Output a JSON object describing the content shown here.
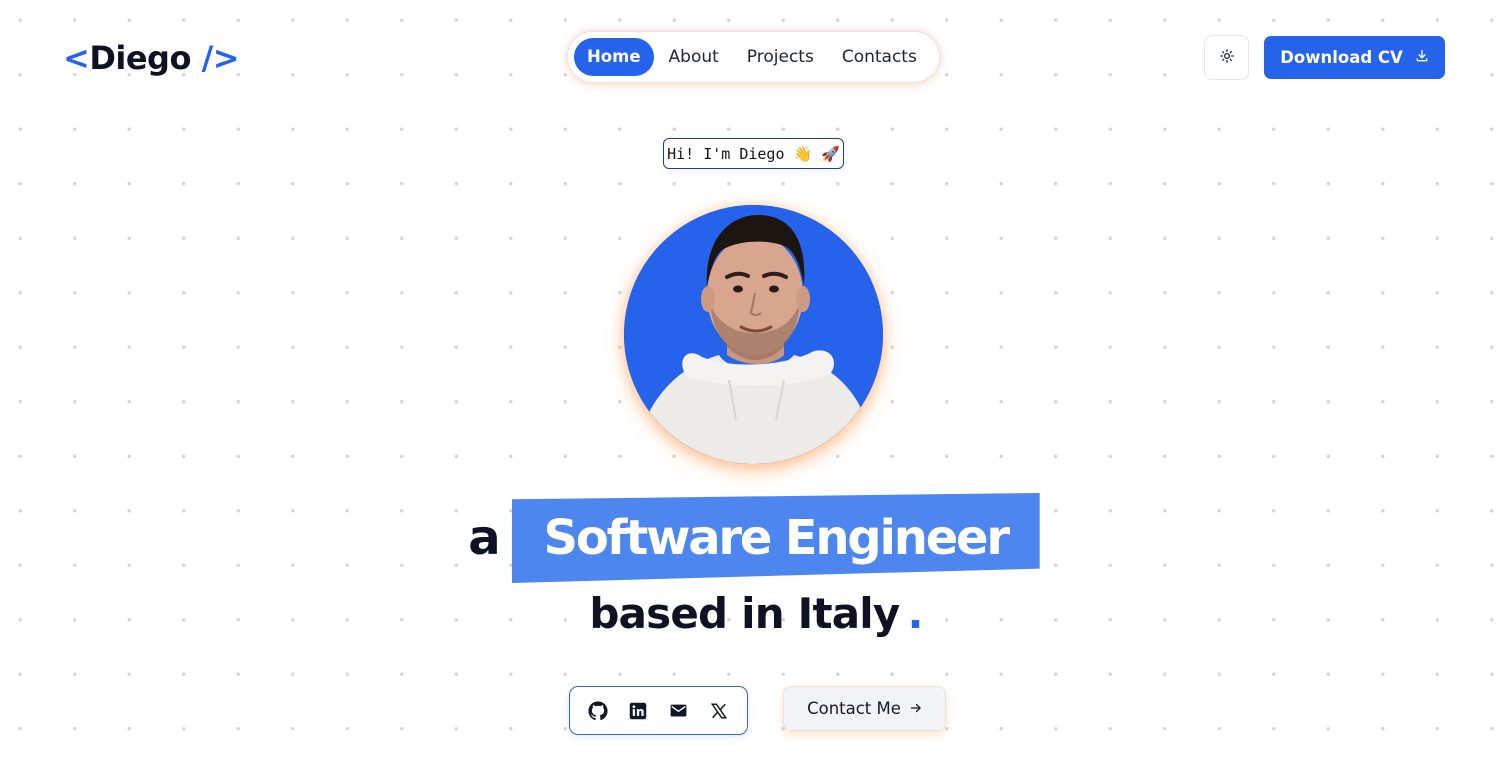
{
  "header": {
    "logo_open": "<",
    "logo_name": "Diego",
    "logo_close": "/>",
    "nav": [
      {
        "label": "Home",
        "active": true
      },
      {
        "label": "About",
        "active": false
      },
      {
        "label": "Projects",
        "active": false
      },
      {
        "label": "Contacts",
        "active": false
      }
    ],
    "theme_icon": "sun-icon",
    "download_label": "Download CV",
    "download_icon": "download-icon"
  },
  "hero": {
    "greeting": "Hi! I'm Diego 👋 🚀",
    "avatar_alt": "avatar",
    "prefix": "a",
    "role": "Software Engineer",
    "location_line": "based in Italy",
    "location_dot": "."
  },
  "links": {
    "socials": [
      {
        "name": "github-icon"
      },
      {
        "name": "linkedin-icon"
      },
      {
        "name": "mail-icon"
      },
      {
        "name": "x-icon"
      }
    ],
    "contact_label": "Contact Me",
    "contact_icon": "arrow-right-icon"
  },
  "colors": {
    "accent": "#2563eb",
    "highlight": "#4d86ee",
    "text": "#0f1222",
    "background": "#ffffff"
  }
}
